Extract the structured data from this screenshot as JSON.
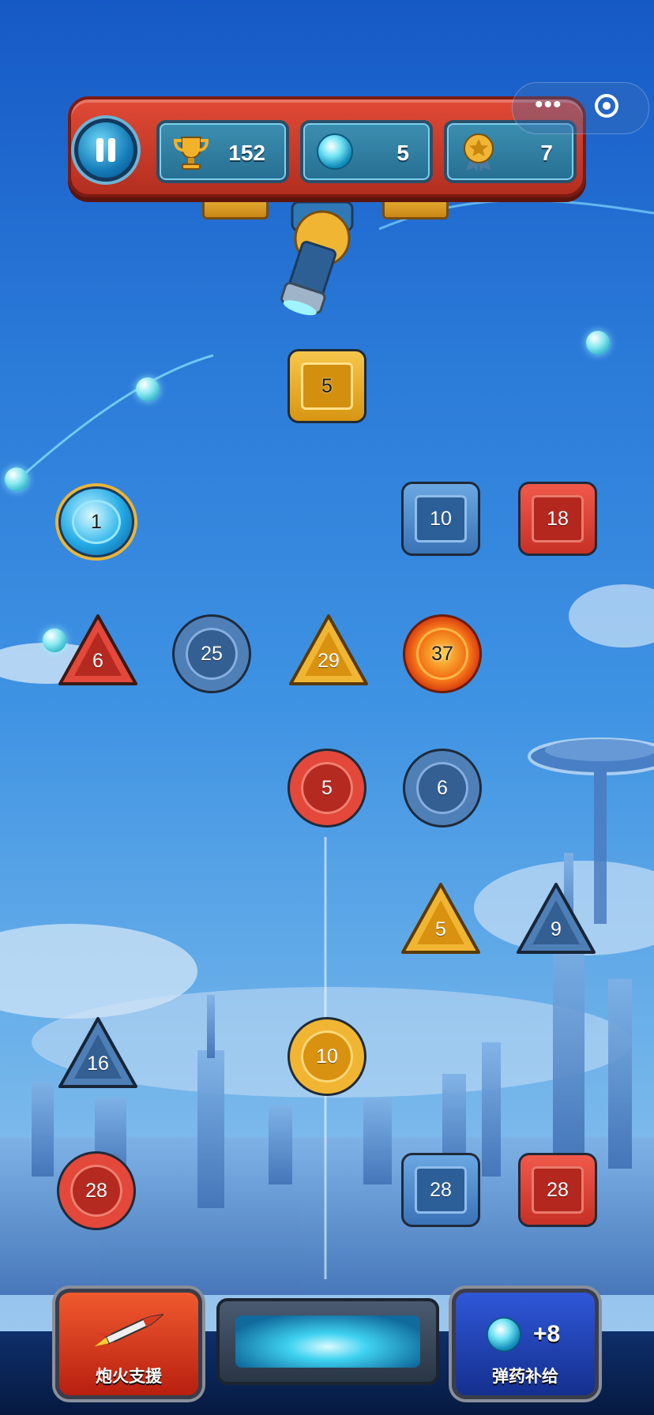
{
  "hud": {
    "trophy_icon": "trophy-icon",
    "score": "152",
    "balls_icon": "energy-ball-icon",
    "balls": "5",
    "medal_icon": "star-medal-icon",
    "level": "7",
    "pause_icon": "pause-icon",
    "menu_icon": "more-dots-icon",
    "close_icon": "target-circle-icon",
    "menu_dots": "•••"
  },
  "blocks": [
    {
      "shape": "square",
      "color": "yellow",
      "value": "5"
    },
    {
      "shape": "circle",
      "color": "ball",
      "value": "1"
    },
    {
      "shape": "square",
      "color": "blue",
      "value": "10"
    },
    {
      "shape": "square",
      "color": "red",
      "value": "18"
    },
    {
      "shape": "triangle",
      "color": "red",
      "value": "6"
    },
    {
      "shape": "circle",
      "color": "blue",
      "value": "25"
    },
    {
      "shape": "triangle",
      "color": "yellow",
      "value": "29"
    },
    {
      "shape": "circle",
      "color": "fire",
      "value": "37"
    },
    {
      "shape": "circle",
      "color": "red",
      "value": "5"
    },
    {
      "shape": "circle",
      "color": "blue",
      "value": "6"
    },
    {
      "shape": "triangle",
      "color": "yellow",
      "value": "5"
    },
    {
      "shape": "triangle",
      "color": "blue",
      "value": "9"
    },
    {
      "shape": "triangle",
      "color": "blue",
      "value": "16"
    },
    {
      "shape": "circle",
      "color": "yellow",
      "value": "10"
    },
    {
      "shape": "circle",
      "color": "red",
      "value": "28"
    },
    {
      "shape": "square",
      "color": "blue",
      "value": "28"
    },
    {
      "shape": "square",
      "color": "red",
      "value": "28"
    }
  ],
  "bottom": {
    "fire_support_label": "炮火支援",
    "fire_support_icon": "rocket-icon",
    "ammo_label": "弹药补给",
    "ammo_icon": "energy-ball-icon",
    "ammo_bonus": "+8",
    "launch_icon": "launch-pad-icon"
  },
  "colors": {
    "sky_top": "#1659c6",
    "red": "#e3483a",
    "blue": "#4f7fb7",
    "yellow": "#f0b533"
  }
}
